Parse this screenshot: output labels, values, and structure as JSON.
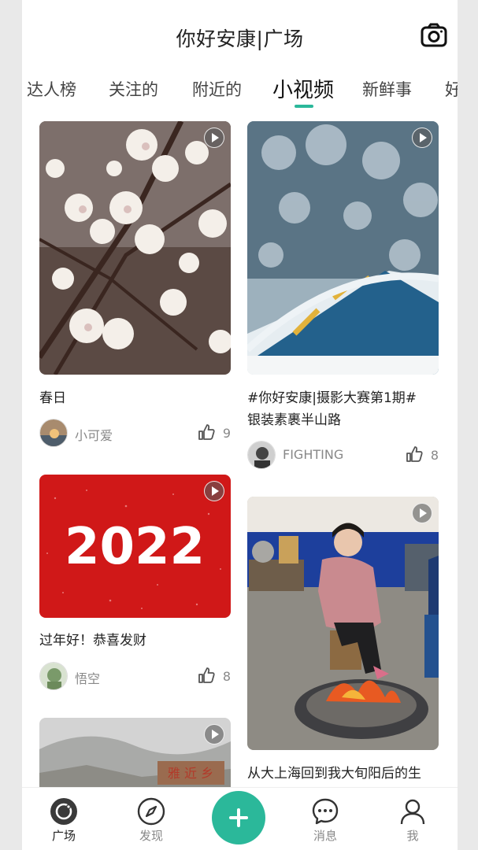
{
  "header": {
    "title": "你好安康|广场",
    "camera_icon": "camera-icon"
  },
  "tabs": [
    {
      "label": "达人榜",
      "active": false
    },
    {
      "label": "关注的",
      "active": false
    },
    {
      "label": "附近的",
      "active": false
    },
    {
      "label": "小视频",
      "active": true
    },
    {
      "label": "新鲜事",
      "active": false
    },
    {
      "label": "好",
      "active": false
    }
  ],
  "accent_color": "#2bb89a",
  "feed": {
    "left": [
      {
        "caption": "春日",
        "user": "小可爱",
        "likes": "9",
        "icon": "play-icon"
      },
      {
        "caption": "过年好！恭喜发财",
        "user": "悟空",
        "likes": "8",
        "icon": "play-icon",
        "image_text": "2022"
      },
      {
        "caption": "",
        "user": "",
        "likes": "",
        "icon": "play-icon",
        "image_text": "雅 近 乡"
      }
    ],
    "right": [
      {
        "caption_line1": "#你好安康|摄影大赛第1期#",
        "caption_line2": "银装素裹半山路",
        "user": "FIGHTING",
        "likes": "8",
        "icon": "play-icon"
      },
      {
        "caption": "从大上海回到我大旬阳后的生",
        "user": "",
        "likes": "",
        "icon": "play-icon"
      }
    ]
  },
  "bottom_nav": [
    {
      "label": "广场",
      "icon": "plaza-icon",
      "active": true
    },
    {
      "label": "发现",
      "icon": "compass-icon",
      "active": false
    },
    {
      "label": "",
      "icon": "add-icon",
      "active": false
    },
    {
      "label": "消息",
      "icon": "message-icon",
      "active": false
    },
    {
      "label": "我",
      "icon": "profile-icon",
      "active": false
    }
  ]
}
